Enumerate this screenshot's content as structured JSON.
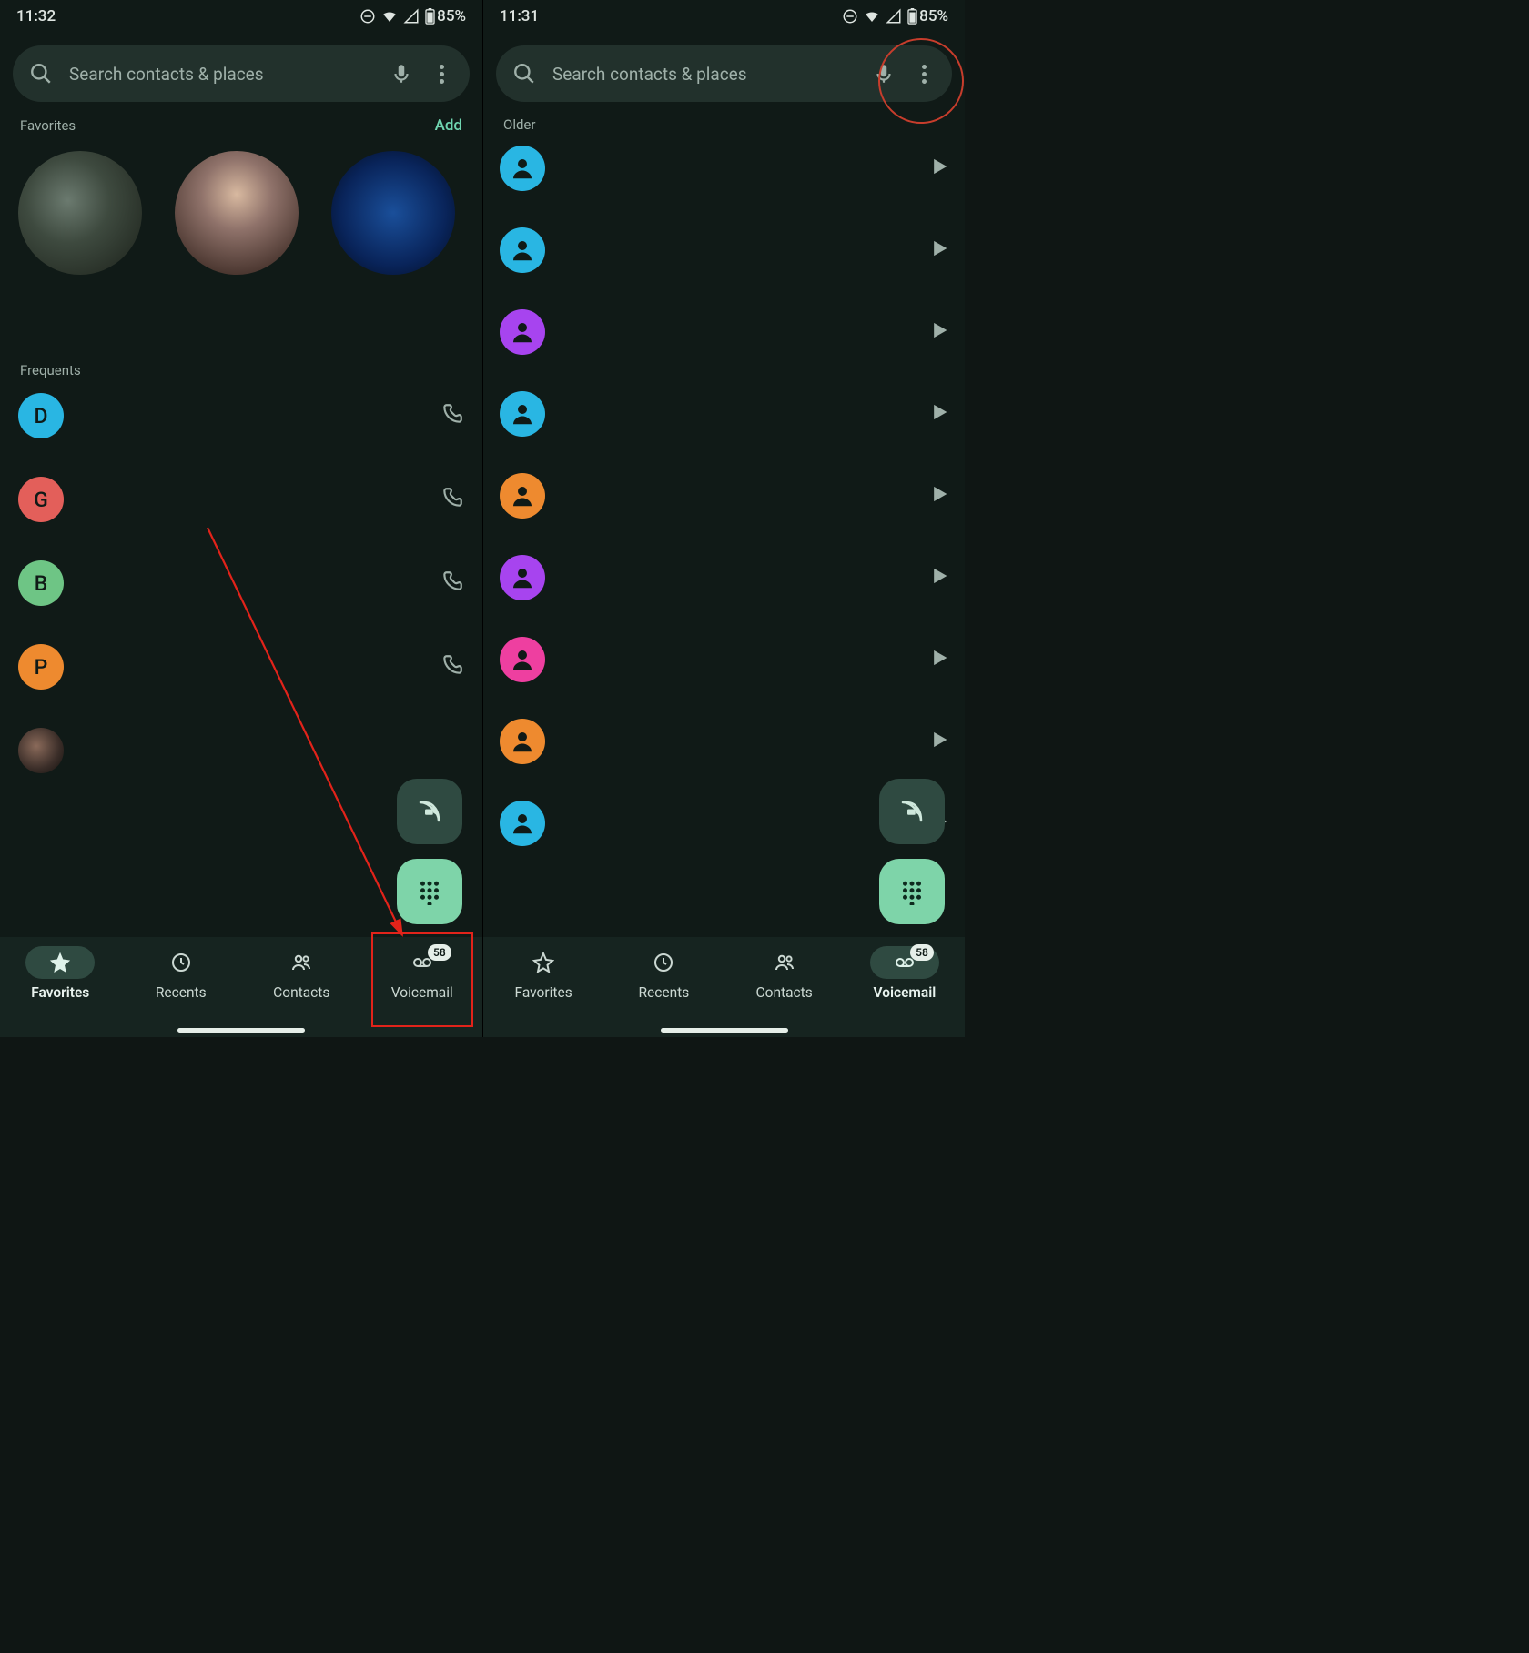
{
  "left": {
    "status": {
      "time": "11:32",
      "battery": "85%"
    },
    "search": {
      "placeholder": "Search contacts & places"
    },
    "favorites": {
      "heading": "Favorites",
      "add": "Add"
    },
    "frequents": {
      "heading": "Frequents",
      "items": [
        {
          "letter": "D",
          "colorClass": "c-cyan"
        },
        {
          "letter": "G",
          "colorClass": "c-red"
        },
        {
          "letter": "B",
          "colorClass": "c-green"
        },
        {
          "letter": "P",
          "colorClass": "c-orange"
        }
      ]
    },
    "nav": {
      "favorites": "Favorites",
      "recents": "Recents",
      "contacts": "Contacts",
      "voicemail": "Voicemail",
      "vm_badge": "58"
    }
  },
  "right": {
    "status": {
      "time": "11:31",
      "battery": "85%"
    },
    "search": {
      "placeholder": "Search contacts & places"
    },
    "older_heading": "Older",
    "vm_items": [
      {
        "colorClass": "c-cyan"
      },
      {
        "colorClass": "c-cyan"
      },
      {
        "colorClass": "c-purple"
      },
      {
        "colorClass": "c-cyan"
      },
      {
        "colorClass": "c-orange"
      },
      {
        "colorClass": "c-purple"
      },
      {
        "colorClass": "c-pink"
      },
      {
        "colorClass": "c-orange"
      },
      {
        "colorClass": "c-cyan"
      }
    ],
    "nav": {
      "favorites": "Favorites",
      "recents": "Recents",
      "contacts": "Contacts",
      "voicemail": "Voicemail",
      "vm_badge": "58"
    }
  }
}
